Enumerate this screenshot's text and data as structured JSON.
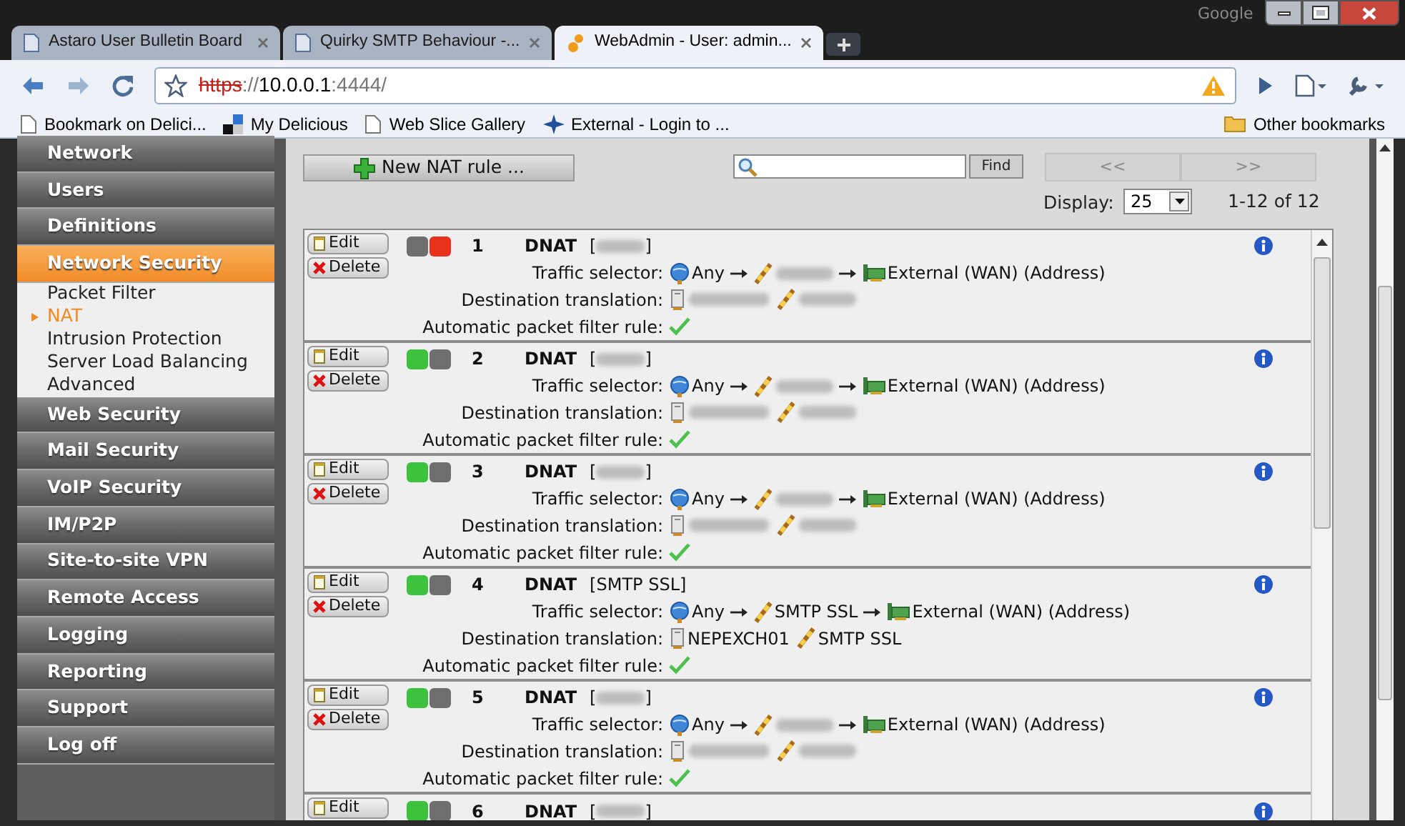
{
  "frame": {
    "label": "Google"
  },
  "tabs": [
    {
      "title": "Astaro User Bulletin Board",
      "selected": false
    },
    {
      "title": "Quirky SMTP Behaviour -...",
      "selected": false
    },
    {
      "title": "WebAdmin - User: admin...",
      "selected": true
    }
  ],
  "address_bar": {
    "url_parts": [
      {
        "text": "https",
        "kind": "insecure"
      },
      {
        "text": "://",
        "kind": "dim"
      },
      {
        "text": "10.0.0.1",
        "kind": "host"
      },
      {
        "text": ":4444/",
        "kind": "dim"
      }
    ]
  },
  "bookmarks": [
    {
      "label": "Bookmark on Delici...",
      "kind": "page"
    },
    {
      "label": "My Delicious",
      "kind": "delicious"
    },
    {
      "label": "Web Slice Gallery",
      "kind": "page"
    },
    {
      "label": "External - Login to ...",
      "kind": "astaro"
    }
  ],
  "other_bookmarks": "Other bookmarks",
  "sidebar": {
    "items": [
      {
        "label": "Network",
        "kind": "section",
        "selected": false
      },
      {
        "label": "Users",
        "kind": "section",
        "selected": false
      },
      {
        "label": "Definitions",
        "kind": "section",
        "selected": false
      },
      {
        "label": "Network Security",
        "kind": "section",
        "selected": true
      },
      {
        "label": "Packet Filter",
        "kind": "sub",
        "selected": false
      },
      {
        "label": "NAT",
        "kind": "sub",
        "selected": true
      },
      {
        "label": "Intrusion Protection",
        "kind": "sub",
        "selected": false
      },
      {
        "label": "Server Load Balancing",
        "kind": "sub",
        "selected": false
      },
      {
        "label": "Advanced",
        "kind": "sub",
        "selected": false
      },
      {
        "label": "Web Security",
        "kind": "section",
        "selected": false
      },
      {
        "label": "Mail Security",
        "kind": "section",
        "selected": false
      },
      {
        "label": "VoIP Security",
        "kind": "section",
        "selected": false
      },
      {
        "label": "IM/P2P",
        "kind": "section",
        "selected": false
      },
      {
        "label": "Site-to-site VPN",
        "kind": "section",
        "selected": false
      },
      {
        "label": "Remote Access",
        "kind": "section",
        "selected": false
      },
      {
        "label": "Logging",
        "kind": "section",
        "selected": false
      },
      {
        "label": "Reporting",
        "kind": "section",
        "selected": false
      },
      {
        "label": "Support",
        "kind": "section",
        "selected": false
      },
      {
        "label": "Log off",
        "kind": "section",
        "selected": false
      }
    ]
  },
  "controls": {
    "new_button": "New NAT rule ...",
    "find_button": "Find",
    "pager": [
      {
        "label": "<<",
        "disabled": true
      },
      {
        "label": ">>",
        "disabled": true
      }
    ],
    "display_label": "Display:",
    "display_value": "25",
    "range": "1-12 of 12"
  },
  "rules": [
    {
      "enabled": false,
      "number": "1",
      "type": "DNAT",
      "name": {
        "redacted": true,
        "open": "[",
        "close": "]"
      },
      "edit": "Edit",
      "delete": "Delete",
      "selector_label": "Traffic selector:",
      "source": {
        "text": "Any"
      },
      "service": {
        "redacted": true
      },
      "destination": {
        "text": "External (WAN) (Address)"
      },
      "translation_label": "Destination translation:",
      "host": {
        "redacted": true
      },
      "translated_service": {
        "redacted": true
      },
      "auto_label": "Automatic packet filter rule:",
      "auto_filter": true
    },
    {
      "enabled": true,
      "number": "2",
      "type": "DNAT",
      "name": {
        "redacted": true,
        "open": "[",
        "close": "]"
      },
      "edit": "Edit",
      "delete": "Delete",
      "selector_label": "Traffic selector:",
      "source": {
        "text": "Any"
      },
      "service": {
        "redacted": true
      },
      "destination": {
        "text": "External (WAN) (Address)"
      },
      "translation_label": "Destination translation:",
      "host": {
        "redacted": true
      },
      "translated_service": {
        "redacted": true
      },
      "auto_label": "Automatic packet filter rule:",
      "auto_filter": true
    },
    {
      "enabled": true,
      "number": "3",
      "type": "DNAT",
      "name": {
        "redacted": true,
        "open": "[",
        "close": "]"
      },
      "edit": "Edit",
      "delete": "Delete",
      "selector_label": "Traffic selector:",
      "source": {
        "text": "Any"
      },
      "service": {
        "redacted": true
      },
      "destination": {
        "text": "External (WAN) (Address)"
      },
      "translation_label": "Destination translation:",
      "host": {
        "redacted": true
      },
      "translated_service": {
        "redacted": true
      },
      "auto_label": "Automatic packet filter rule:",
      "auto_filter": true
    },
    {
      "enabled": true,
      "number": "4",
      "type": "DNAT",
      "name": {
        "text": "[SMTP SSL]"
      },
      "edit": "Edit",
      "delete": "Delete",
      "selector_label": "Traffic selector:",
      "source": {
        "text": "Any"
      },
      "service": {
        "text": "SMTP SSL"
      },
      "destination": {
        "text": "External (WAN) (Address)"
      },
      "translation_label": "Destination translation:",
      "host": {
        "text": "NEPEXCH01"
      },
      "translated_service": {
        "text": "SMTP SSL"
      },
      "auto_label": "Automatic packet filter rule:",
      "auto_filter": true
    },
    {
      "enabled": true,
      "number": "5",
      "type": "DNAT",
      "name": {
        "redacted": true,
        "open": "[",
        "close": "]"
      },
      "edit": "Edit",
      "delete": "Delete",
      "selector_label": "Traffic selector:",
      "source": {
        "text": "Any"
      },
      "service": {
        "redacted": true
      },
      "destination": {
        "text": "External (WAN) (Address)"
      },
      "translation_label": "Destination translation:",
      "host": {
        "redacted": true
      },
      "translated_service": {
        "redacted": true
      },
      "auto_label": "Automatic packet filter rule:",
      "auto_filter": true
    },
    {
      "enabled": true,
      "number": "6",
      "type": "DNAT",
      "name": {
        "redacted": true,
        "open": "[",
        "close": "]"
      },
      "edit": "Edit"
    }
  ]
}
